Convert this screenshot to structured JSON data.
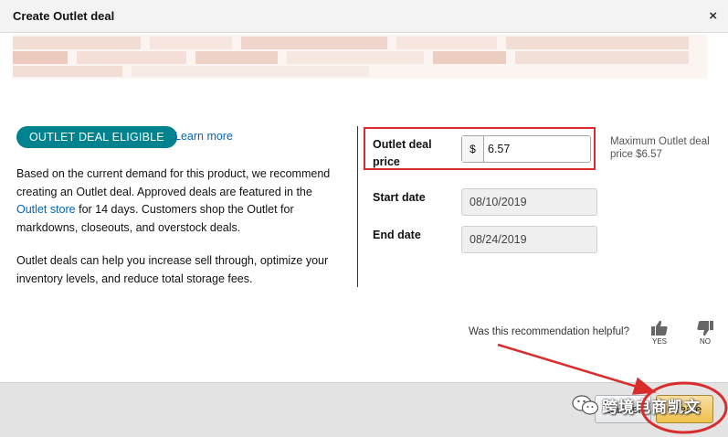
{
  "dialog": {
    "title": "Create Outlet deal",
    "close_symbol": "×"
  },
  "eligibility": {
    "badge": "OUTLET DEAL ELIGIBLE",
    "learn_more": "Learn more"
  },
  "description": {
    "part1": "Based on the current demand for this product, we recommend creating an Outlet deal. Approved deals are featured in the ",
    "link": "Outlet store",
    "part2": " for 14 days. Customers shop the Outlet for markdowns, closeouts, and overstock deals.",
    "second": "Outlet deals can help you increase sell through, optimize your inventory levels, and reduce total storage fees."
  },
  "form": {
    "price_label_line1": "Outlet deal",
    "price_label_line2": "price",
    "currency": "$",
    "price_value": "6.57",
    "max_note": "Maximum Outlet deal price $6.57",
    "start_label": "Start date",
    "start_value": "08/10/2019",
    "end_label": "End date",
    "end_value": "08/24/2019"
  },
  "feedback": {
    "question": "Was this recommendation helpful?",
    "yes": "YES",
    "no": "NO"
  },
  "footer": {
    "cancel": "Cancel",
    "create": "Create"
  },
  "watermark": {
    "text": "跨境电商凯文"
  },
  "colors": {
    "badge": "#00838f",
    "link": "#0066c0",
    "annotation": "#d92d2d",
    "primary_button": "#f0c14b"
  }
}
